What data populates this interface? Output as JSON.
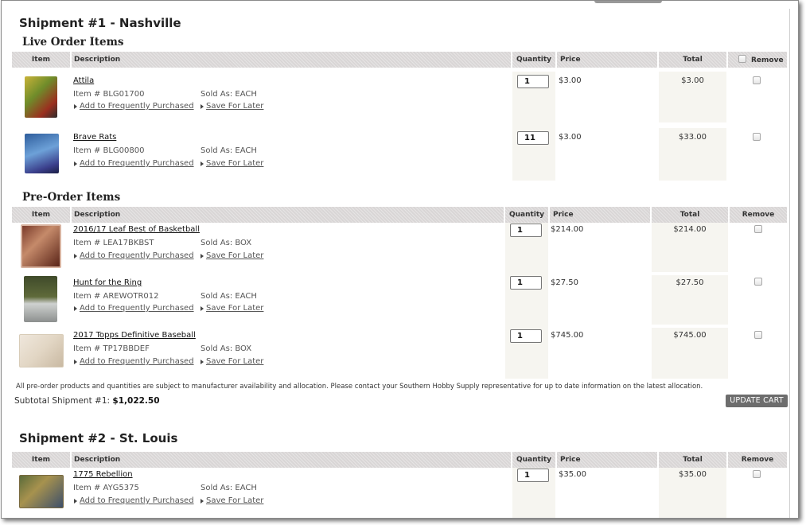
{
  "shipments": [
    {
      "title": "Shipment #1 - Nashville",
      "live_section_title": "Live Order Items",
      "preorder_section_title": "Pre-Order Items",
      "live_items": [
        {
          "name": "Attila",
          "item_no": "Item # BLG01700",
          "sold_as": "Sold As: EACH",
          "qty": "1",
          "price": "$3.00",
          "total": "$3.00"
        },
        {
          "name": "Brave Rats",
          "item_no": "Item # BLG00800",
          "sold_as": "Sold As: EACH",
          "qty": "11",
          "price": "$3.00",
          "total": "$33.00"
        }
      ],
      "preorder_items": [
        {
          "name": "2016/17 Leaf Best of Basketball",
          "item_no": "Item # LEA17BKBST",
          "sold_as": "Sold As: BOX",
          "qty": "1",
          "price": "$214.00",
          "total": "$214.00"
        },
        {
          "name": "Hunt for the Ring",
          "item_no": "Item # AREWOTR012",
          "sold_as": "Sold As: EACH",
          "qty": "1",
          "price": "$27.50",
          "total": "$27.50"
        },
        {
          "name": "2017 Topps Definitive Baseball",
          "item_no": "Item # TP17BBDEF",
          "sold_as": "Sold As: BOX",
          "qty": "1",
          "price": "$745.00",
          "total": "$745.00"
        }
      ],
      "preorder_note": "All pre-order products and quantities are subject to manufacturer availability and allocation. Please contact your Southern Hobby Supply representative for up to date information on the latest allocation.",
      "subtotal_label": "Subtotal Shipment #1:",
      "subtotal_value": "$1,022.50",
      "update_button": "UPDATE CART"
    },
    {
      "title": "Shipment #2 - St. Louis",
      "live_items": [
        {
          "name": "1775 Rebellion",
          "item_no": "Item # AYG5375",
          "sold_as": "Sold As: EACH",
          "qty": "1",
          "price": "$35.00",
          "total": "$35.00"
        }
      ]
    }
  ],
  "columns": {
    "item": "Item",
    "description": "Description",
    "quantity": "Quantity",
    "price": "Price",
    "total": "Total",
    "remove": "Remove"
  },
  "actions": {
    "add_frequent": "Add to Frequently Purchased",
    "save_later": "Save For Later"
  },
  "icons": [
    "checkbox-icon",
    "caret-right-icon"
  ],
  "colors": {
    "header_bg": "#d9d6d6",
    "shade_bg": "#f6f5f0",
    "button_bg": "#6d6d6d"
  }
}
